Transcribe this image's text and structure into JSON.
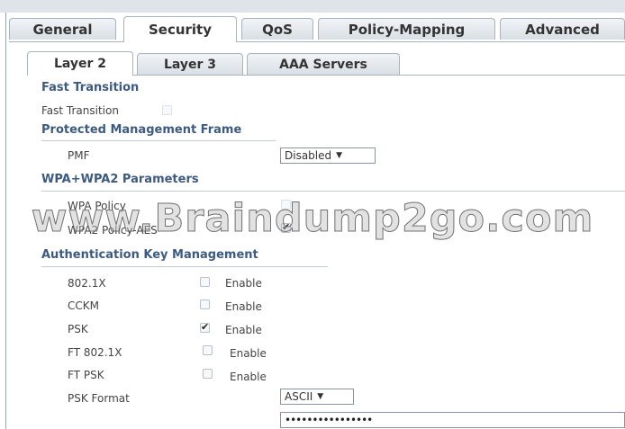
{
  "tabs": [
    "General",
    "Security",
    "QoS",
    "Policy-Mapping",
    "Advanced"
  ],
  "active_tab": "Security",
  "subtabs": [
    "Layer 2",
    "Layer 3",
    "AAA Servers"
  ],
  "active_subtab": "Layer 2",
  "fast_transition": {
    "heading": "Fast Transition",
    "label": "Fast Transition",
    "checked": false
  },
  "pmf": {
    "heading": "Protected Management Frame",
    "label": "PMF",
    "value": "Disabled"
  },
  "wpa": {
    "heading": "WPA+WPA2 Parameters",
    "wpa_policy_label": "WPA Policy",
    "wpa_policy_checked": false,
    "wpa2_policy_label": "WPA2 Policy-AES",
    "wpa2_policy_checked": true
  },
  "akm": {
    "heading": "Authentication Key Management",
    "enable_text": "Enable",
    "items": [
      {
        "label": "802.1X",
        "checked": false
      },
      {
        "label": "CCKM",
        "checked": false
      },
      {
        "label": "PSK",
        "checked": true
      },
      {
        "label": "FT 802.1X",
        "checked": false
      },
      {
        "label": "FT PSK",
        "checked": false
      }
    ],
    "psk_format_label": "PSK Format",
    "psk_format_value": "ASCII",
    "psk_value": "••••••••••••••••"
  },
  "watermark": "www.Braindump2go.com"
}
